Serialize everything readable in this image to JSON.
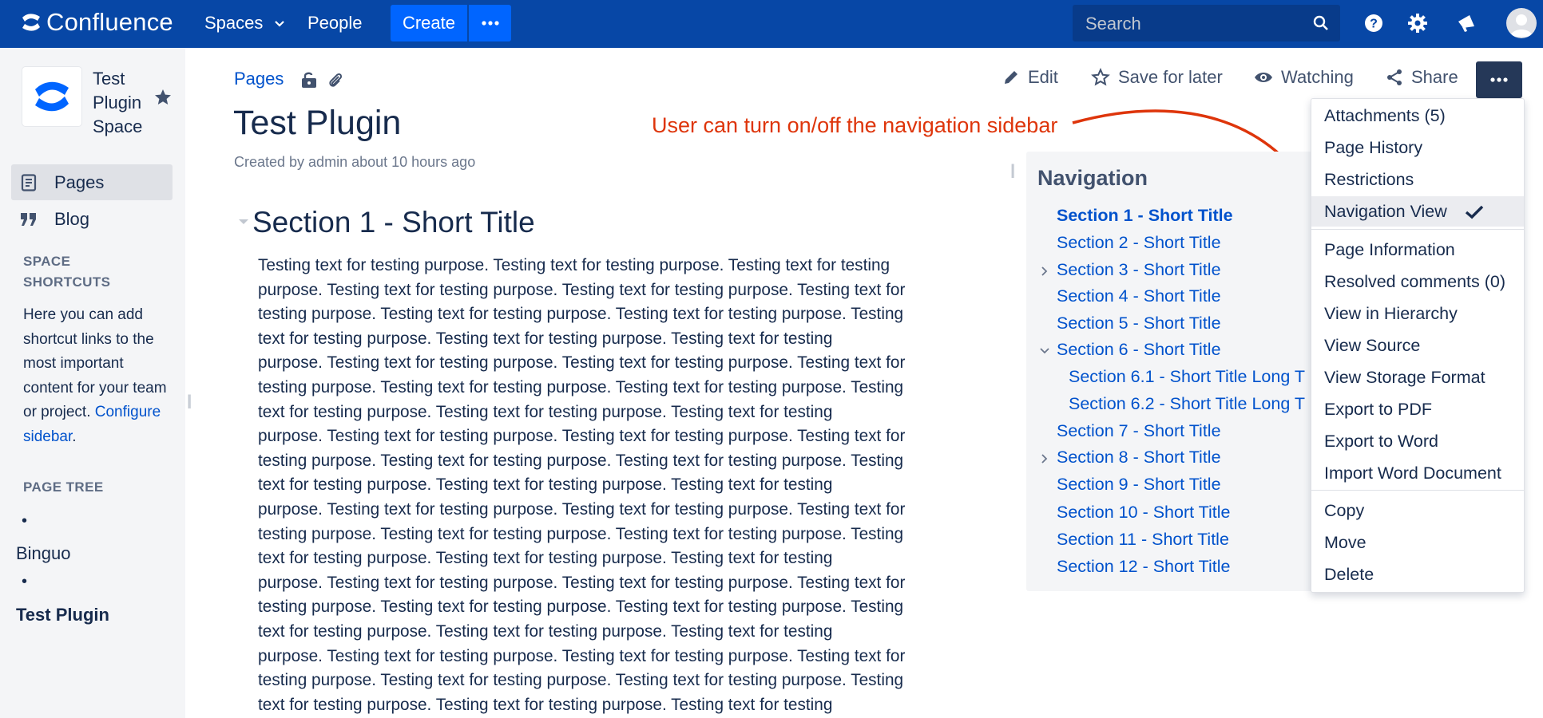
{
  "topbar": {
    "app_name": "Confluence",
    "spaces_label": "Spaces",
    "people_label": "People",
    "create_label": "Create",
    "search_placeholder": "Search"
  },
  "sidebar": {
    "space_name": "Test Plugin Space",
    "items": [
      {
        "label": "Pages",
        "icon": "pages-icon",
        "active": true
      },
      {
        "label": "Blog",
        "icon": "quote-icon",
        "active": false
      }
    ],
    "shortcuts_heading": "SPACE SHORTCUTS",
    "shortcuts_text": "Here you can add shortcut links to the most important content for your team or project.",
    "configure_link": "Configure sidebar",
    "configure_suffix": ".",
    "page_tree_heading": "PAGE TREE",
    "tree": [
      {
        "bullet": "•",
        "label": "Binguo"
      },
      {
        "bullet": "•",
        "label": "Test Plugin"
      }
    ]
  },
  "page": {
    "breadcrumb": "Pages",
    "title": "Test Plugin",
    "byline": "Created by admin about 10 hours ago",
    "actions": {
      "edit": "Edit",
      "save_for_later": "Save for later",
      "watching": "Watching",
      "share": "Share"
    },
    "annotation": "User can turn on/off the navigation sidebar",
    "section_title": "Section 1 - Short Title",
    "body_lines": [
      "Testing text for testing purpose. Testing text for testing purpose. Testing text for testing",
      "purpose. Testing text for testing purpose. Testing text for testing purpose. Testing text for",
      "testing purpose. Testing text for testing purpose. Testing text for testing purpose. Testing",
      "text for testing purpose. Testing text for testing purpose. Testing text for testing",
      "purpose. Testing text for testing purpose. Testing text for testing purpose. Testing text for",
      "testing purpose. Testing text for testing purpose. Testing text for testing purpose. Testing",
      "text for testing purpose. Testing text for testing purpose. Testing text for testing",
      "purpose. Testing text for testing purpose. Testing text for testing purpose. Testing text for",
      "testing purpose. Testing text for testing purpose. Testing text for testing purpose. Testing",
      "text for testing purpose. Testing text for testing purpose. Testing text for testing",
      "purpose. Testing text for testing purpose. Testing text for testing purpose. Testing text for",
      "testing purpose. Testing text for testing purpose. Testing text for testing purpose. Testing",
      "text for testing purpose. Testing text for testing purpose. Testing text for testing",
      "purpose. Testing text for testing purpose. Testing text for testing purpose. Testing text for",
      "testing purpose. Testing text for testing purpose. Testing text for testing purpose. Testing",
      "text for testing purpose. Testing text for testing purpose. Testing text for testing",
      "purpose. Testing text for testing purpose. Testing text for testing purpose. Testing text for",
      "testing purpose. Testing text for testing purpose. Testing text for testing purpose. Testing",
      "text for testing purpose. Testing text for testing purpose. Testing text for testing"
    ]
  },
  "navigation": {
    "title": "Navigation",
    "items": [
      {
        "label": "Section 1 - Short Title",
        "current": true,
        "level": 1,
        "toggle": "none"
      },
      {
        "label": "Section 2 - Short Title",
        "current": false,
        "level": 1,
        "toggle": "none"
      },
      {
        "label": "Section 3 - Short Title",
        "current": false,
        "level": 1,
        "toggle": "collapsed"
      },
      {
        "label": "Section 4 - Short Title",
        "current": false,
        "level": 1,
        "toggle": "none"
      },
      {
        "label": "Section 5 - Short Title",
        "current": false,
        "level": 1,
        "toggle": "none"
      },
      {
        "label": "Section 6 - Short Title",
        "current": false,
        "level": 1,
        "toggle": "expanded"
      },
      {
        "label": "Section 6.1 - Short Title Long T",
        "current": false,
        "level": 2,
        "toggle": "none"
      },
      {
        "label": "Section 6.2 - Short Title Long T",
        "current": false,
        "level": 2,
        "toggle": "none"
      },
      {
        "label": "Section 7 - Short Title",
        "current": false,
        "level": 1,
        "toggle": "none"
      },
      {
        "label": "Section 8 - Short Title",
        "current": false,
        "level": 1,
        "toggle": "collapsed"
      },
      {
        "label": "Section 9 - Short Title",
        "current": false,
        "level": 1,
        "toggle": "none"
      },
      {
        "label": "Section 10 - Short Title",
        "current": false,
        "level": 1,
        "toggle": "none"
      },
      {
        "label": "Section 11 - Short Title",
        "current": false,
        "level": 1,
        "toggle": "none"
      },
      {
        "label": "Section 12 - Short Title",
        "current": false,
        "level": 1,
        "toggle": "none"
      }
    ]
  },
  "more_menu": {
    "items": [
      {
        "label": "Attachments (5)",
        "checked": false
      },
      {
        "label": "Page History",
        "checked": false
      },
      {
        "label": "Restrictions",
        "checked": false
      },
      {
        "label": "Navigation View",
        "checked": true
      },
      {
        "label": "Page Information",
        "checked": false
      },
      {
        "label": "Resolved comments (0)",
        "checked": false
      },
      {
        "label": "View in Hierarchy",
        "checked": false
      },
      {
        "label": "View Source",
        "checked": false
      },
      {
        "label": "View Storage Format",
        "checked": false
      },
      {
        "label": "Export to PDF",
        "checked": false
      },
      {
        "label": "Export to Word",
        "checked": false
      },
      {
        "label": "Import Word Document",
        "checked": false
      },
      {
        "label": "Copy",
        "checked": false
      },
      {
        "label": "Move",
        "checked": false
      },
      {
        "label": "Delete",
        "checked": false
      }
    ]
  },
  "colors": {
    "topbar": "#0747a6",
    "create_button": "#0065ff",
    "link": "#0052cc",
    "annotation": "#de350b",
    "sidebar": "#f4f5f7"
  }
}
